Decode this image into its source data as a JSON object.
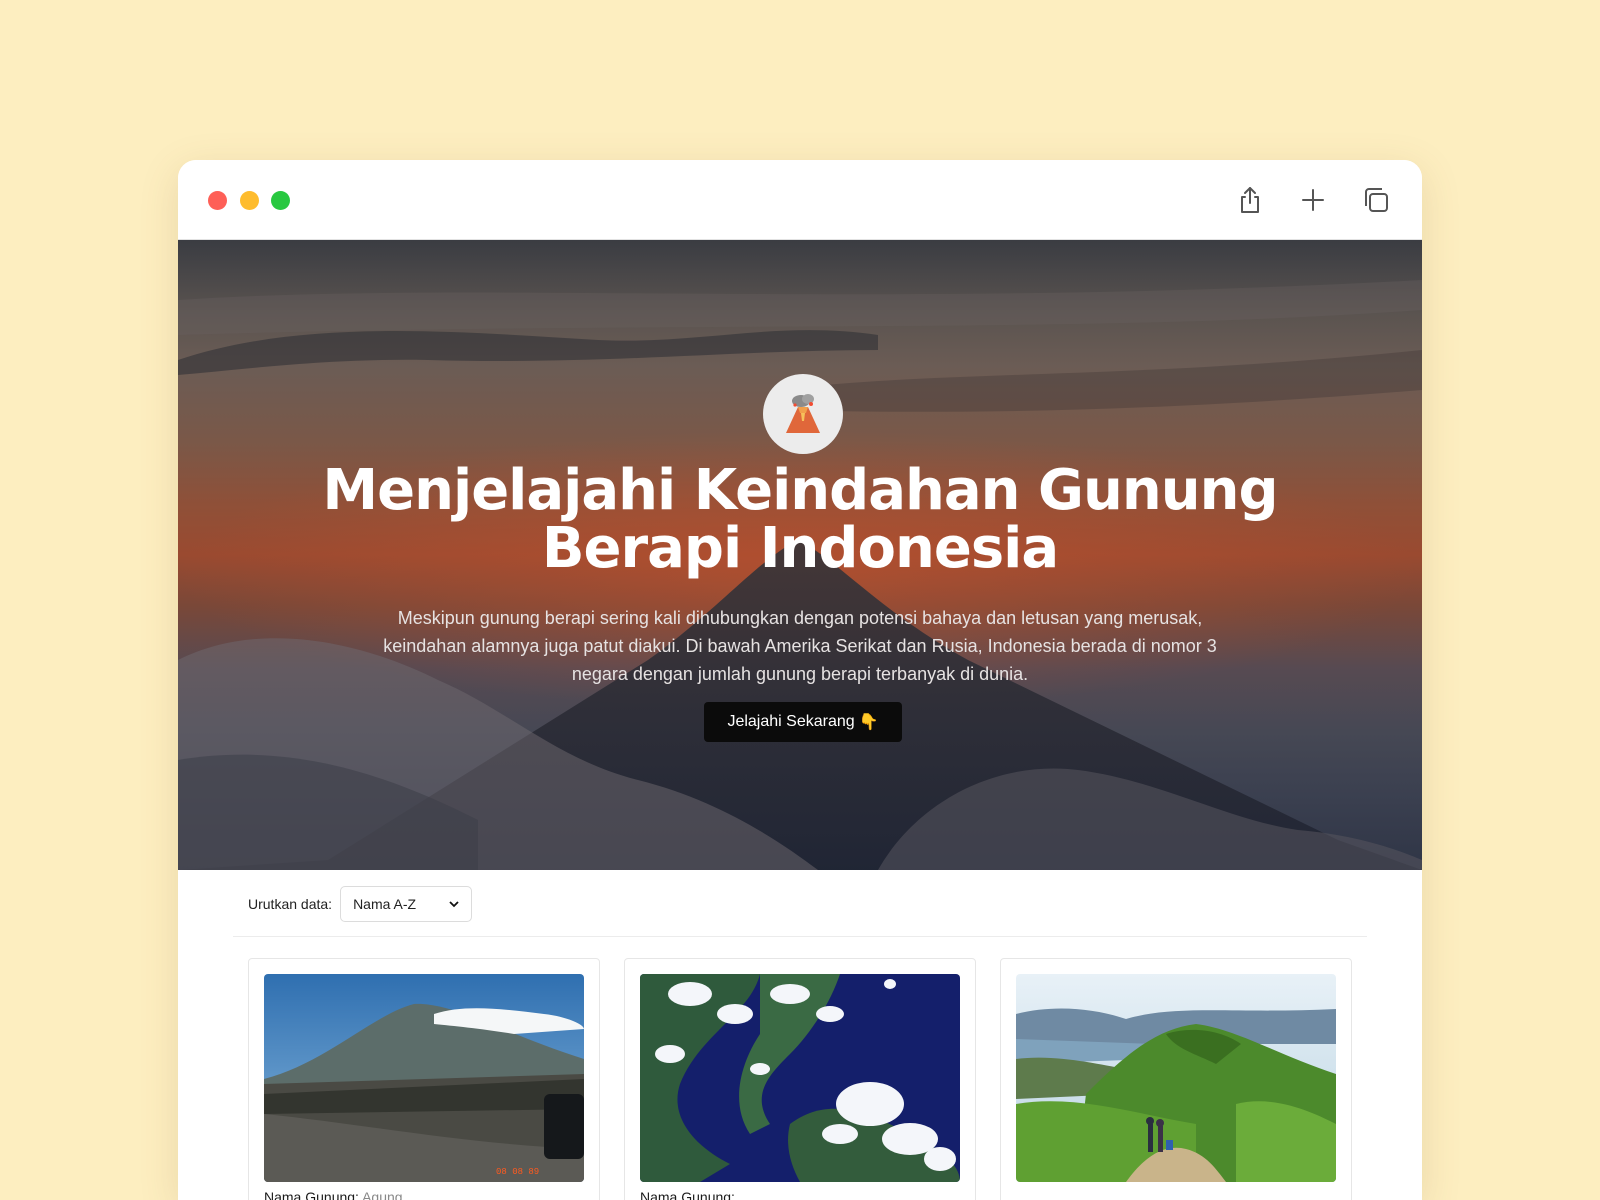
{
  "hero": {
    "logo_icon": "volcano-icon",
    "title": "Menjelajahi Keindahan Gunung Berapi Indonesia",
    "description": "Meskipun gunung berapi sering kali dihubungkan dengan potensi bahaya dan letusan yang merusak, keindahan alamnya juga patut diakui. Di bawah Amerika Serikat dan Rusia, Indonesia berada di nomor 3 negara dengan jumlah gunung berapi terbanyak di dunia.",
    "button_label": "Jelajahi Sekarang",
    "button_icon": "pointing-down-hand-icon"
  },
  "toolbar": {
    "icons": [
      "share-icon",
      "plus-icon",
      "tabs-icon"
    ]
  },
  "sort": {
    "label": "Urutkan data:",
    "selected": "Nama A-Z"
  },
  "cards": [
    {
      "caption_label": "Nama Gunung:",
      "caption_value": "Agung",
      "image": "agung-volcano-photo"
    },
    {
      "caption_label": "Nama Gunung:",
      "caption_value": "",
      "image": "satellite-island-photo"
    },
    {
      "caption_label": "",
      "caption_value": "",
      "image": "green-hills-lake-photo"
    }
  ],
  "colors": {
    "page_background": "#fdeec0",
    "button": "#0b0b0b",
    "traffic_red": "#fe5f57",
    "traffic_yellow": "#febc2e",
    "traffic_green": "#28c840"
  }
}
